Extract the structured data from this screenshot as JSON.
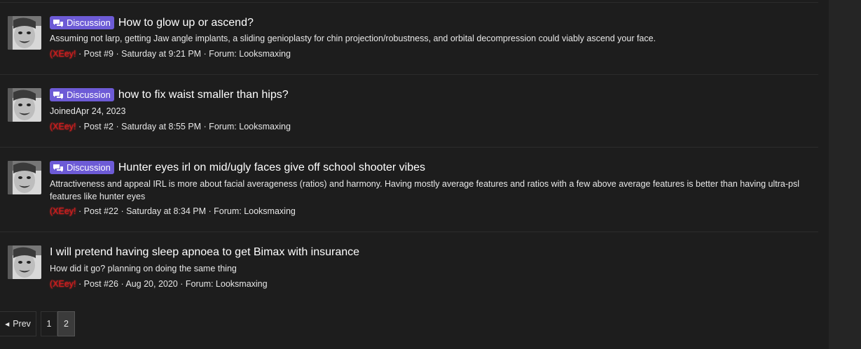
{
  "results": [
    {
      "badge": "Discussion",
      "title": "How to glow up or ascend?",
      "snippet": "Assuming not larp, getting Jaw angle implants, a sliding genioplasty for chin projection/robustness, and orbital decompression could viably ascend your face.",
      "user": "(XEey!",
      "meta": " · Post #9 · Saturday at 9:21 PM · Forum: Looksmaxing"
    },
    {
      "badge": "Discussion",
      "title": "how to fix waist smaller than hips?",
      "snippet": "JoinedApr 24, 2023",
      "user": "(XEey!",
      "meta": " · Post #2 · Saturday at 8:55 PM · Forum: Looksmaxing"
    },
    {
      "badge": "Discussion",
      "title": "Hunter eyes irl on mid/ugly faces give off school shooter vibes",
      "snippet": "Attractiveness and appeal IRL is more about facial averageness (ratios) and harmony. Having mostly average features and ratios with a few above average features is better than having ultra-psl features like hunter eyes",
      "user": "(XEey!",
      "meta": " · Post #22 · Saturday at 8:34 PM · Forum: Looksmaxing"
    },
    {
      "badge": "",
      "title": "I will pretend having sleep apnoea to get Bimax with insurance",
      "snippet": "How did it go? planning on doing the same thing",
      "user": "(XEey!",
      "meta": " · Post #26 · Aug 20, 2020 · Forum: Looksmaxing"
    }
  ],
  "pagination": {
    "prev": "Prev",
    "pages": [
      "1",
      "2"
    ],
    "current": "2"
  },
  "colors": {
    "badge": "#6d5bd6",
    "username": "#d11c1c",
    "background": "#1d1d1d"
  },
  "icons": {
    "badge_icon": "chat-bubbles-icon",
    "prev_icon": "caret-left-icon"
  }
}
